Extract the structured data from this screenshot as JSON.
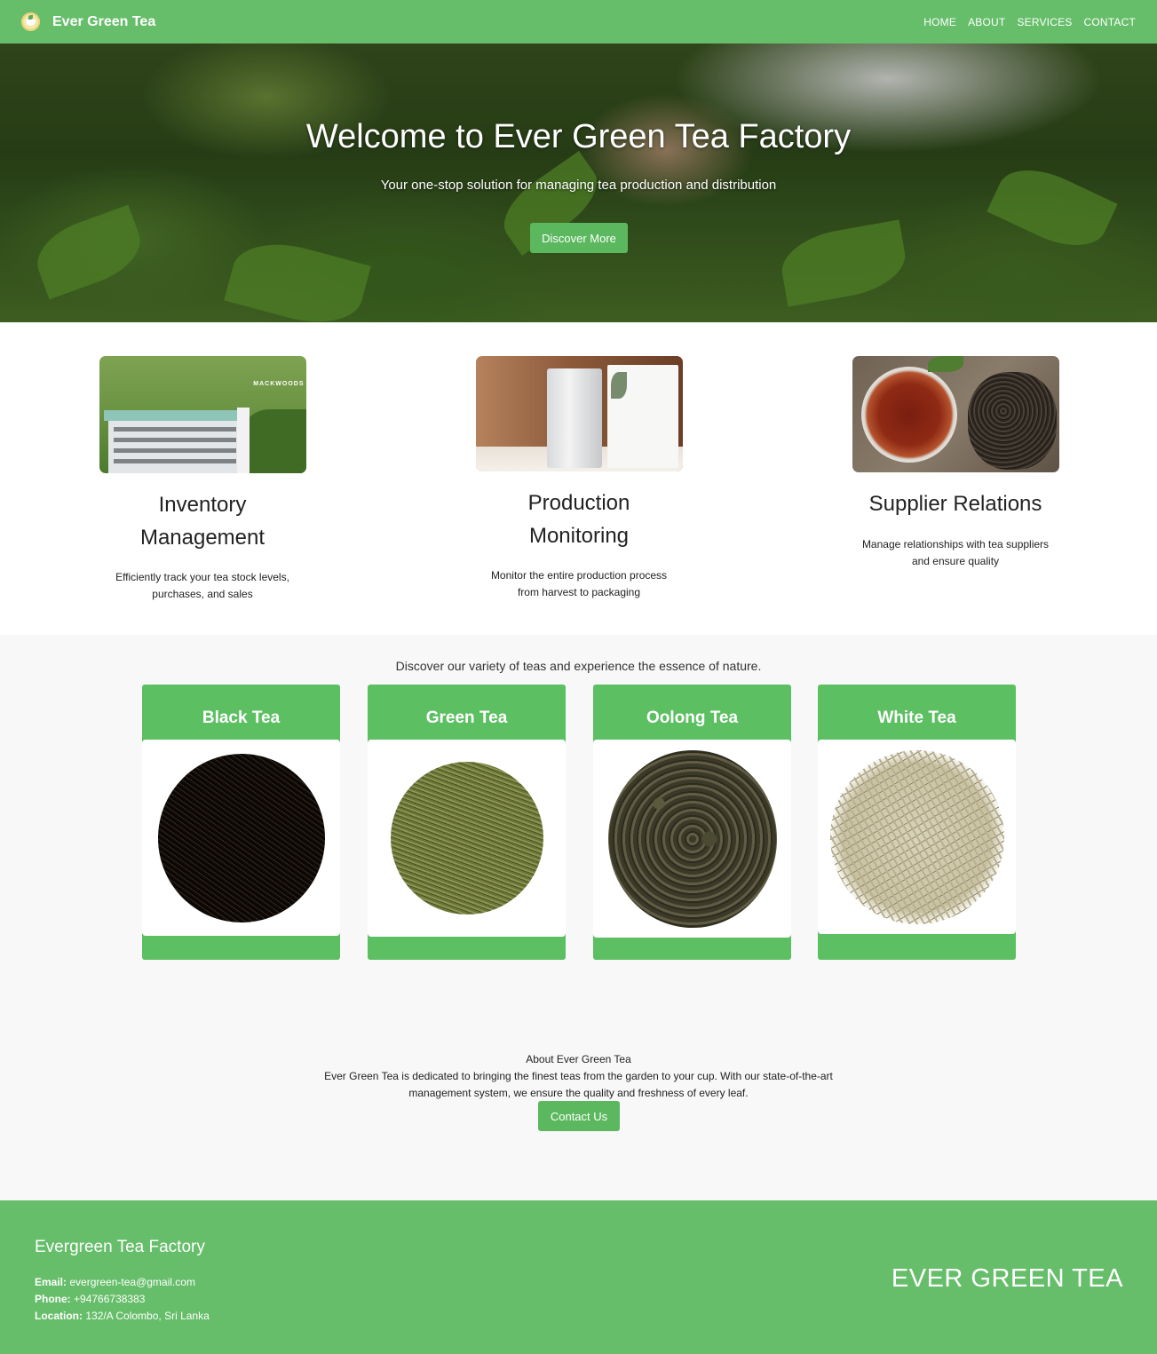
{
  "nav": {
    "brand": "Ever Green Tea",
    "logo_icon": "tea-cup-logo-icon",
    "links": [
      "HOME",
      "ABOUT",
      "SERVICES",
      "CONTACT"
    ],
    "color": "#66be6a"
  },
  "hero": {
    "title": "Welcome to Ever Green Tea Factory",
    "subtitle": "Your one-stop solution for managing tea production and distribution",
    "button": "Discover More"
  },
  "features": [
    {
      "title_line1": "Inventory",
      "title_line2": "Management",
      "desc_line1": "Efficiently track your tea stock levels,",
      "desc_line2": "purchases, and sales",
      "image_text": "MACKWOODS"
    },
    {
      "title_line1": "Production",
      "title_line2": "Monitoring",
      "desc_line1": "Monitor the entire production process",
      "desc_line2": "from harvest to packaging"
    },
    {
      "title_line1": "Supplier Relations",
      "desc_line1": "Manage relationships with tea suppliers",
      "desc_line2": "and ensure quality"
    }
  ],
  "teas": {
    "intro": "Discover our variety of teas and experience the essence of nature.",
    "items": [
      "Black Tea",
      "Green Tea",
      "Oolong Tea",
      "White Tea"
    ],
    "card_color": "#5cbf62"
  },
  "about": {
    "title": "About Ever Green Tea",
    "text": "Ever Green Tea is dedicated to bringing the finest teas from the garden to your cup. With our state-of-the-art management system, we ensure the quality and freshness of every leaf.",
    "button": "Contact Us"
  },
  "footer": {
    "title": "Evergreen Tea Factory",
    "email_label": "Email:",
    "email": "evergreen-tea@gmail.com",
    "phone_label": "Phone:",
    "phone": "+94766738383",
    "location_label": "Location:",
    "location": "132/A Colombo, Sri Lanka",
    "brand": "EVER GREEN TEA"
  }
}
